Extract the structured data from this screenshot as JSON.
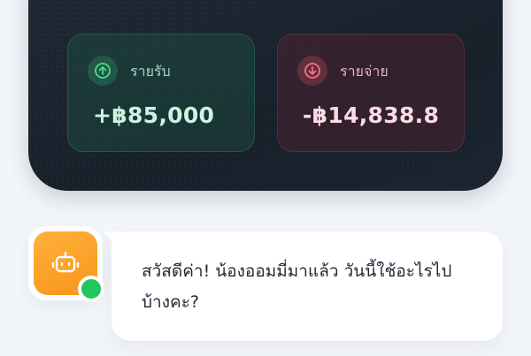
{
  "summary": {
    "income": {
      "label": "รายรับ",
      "value": "+฿85,000",
      "icon": "arrow-up-circle-icon",
      "color": "#34d399"
    },
    "expense": {
      "label": "รายจ่าย",
      "value": "-฿14,838.8",
      "icon": "arrow-down-circle-icon",
      "color": "#f472b6"
    }
  },
  "assistant": {
    "avatar_icon": "robot-icon",
    "status": "online",
    "status_color": "#22c55e",
    "message": "สวัสดีค่า! น้องออมมี่มาแล้ว วันนี้ใช้อะไรไปบ้างคะ?"
  }
}
